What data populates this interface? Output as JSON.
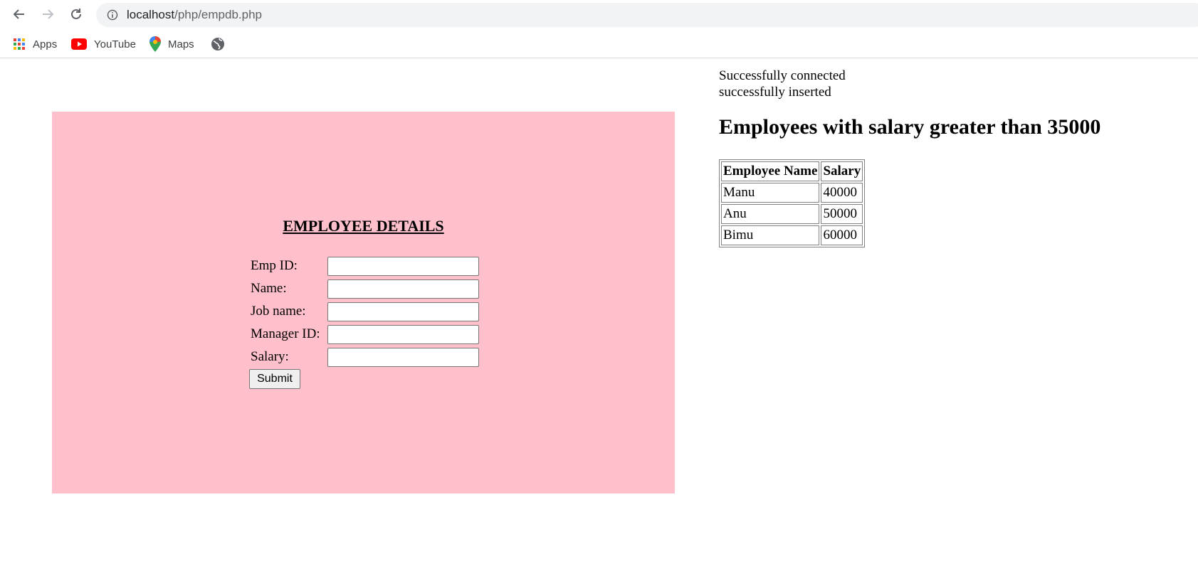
{
  "browser": {
    "url_host": "localhost",
    "url_path": "/php/empdb.php",
    "bookmarks": [
      {
        "label": "Apps",
        "icon": "apps-grid-icon"
      },
      {
        "label": "YouTube",
        "icon": "youtube-icon"
      },
      {
        "label": "Maps",
        "icon": "maps-pin-icon"
      },
      {
        "label": "",
        "icon": "globe-icon"
      }
    ]
  },
  "form": {
    "title": "EMPLOYEE DETAILS",
    "fields": [
      {
        "label": "Emp ID:",
        "value": ""
      },
      {
        "label": "Name:",
        "value": ""
      },
      {
        "label": "Job name:",
        "value": ""
      },
      {
        "label": "Manager ID:",
        "value": ""
      },
      {
        "label": "Salary:",
        "value": ""
      }
    ],
    "submit_label": "Submit",
    "panel_color": "#ffc0cb"
  },
  "status": {
    "line1": "Successfully connected",
    "line2": "successfully inserted"
  },
  "results": {
    "title": "Employees with salary greater than 35000",
    "headers": [
      "Employee Name",
      "Salary"
    ],
    "rows": [
      [
        "Manu",
        "40000"
      ],
      [
        "Anu",
        "50000"
      ],
      [
        "Bimu",
        "60000"
      ]
    ]
  }
}
